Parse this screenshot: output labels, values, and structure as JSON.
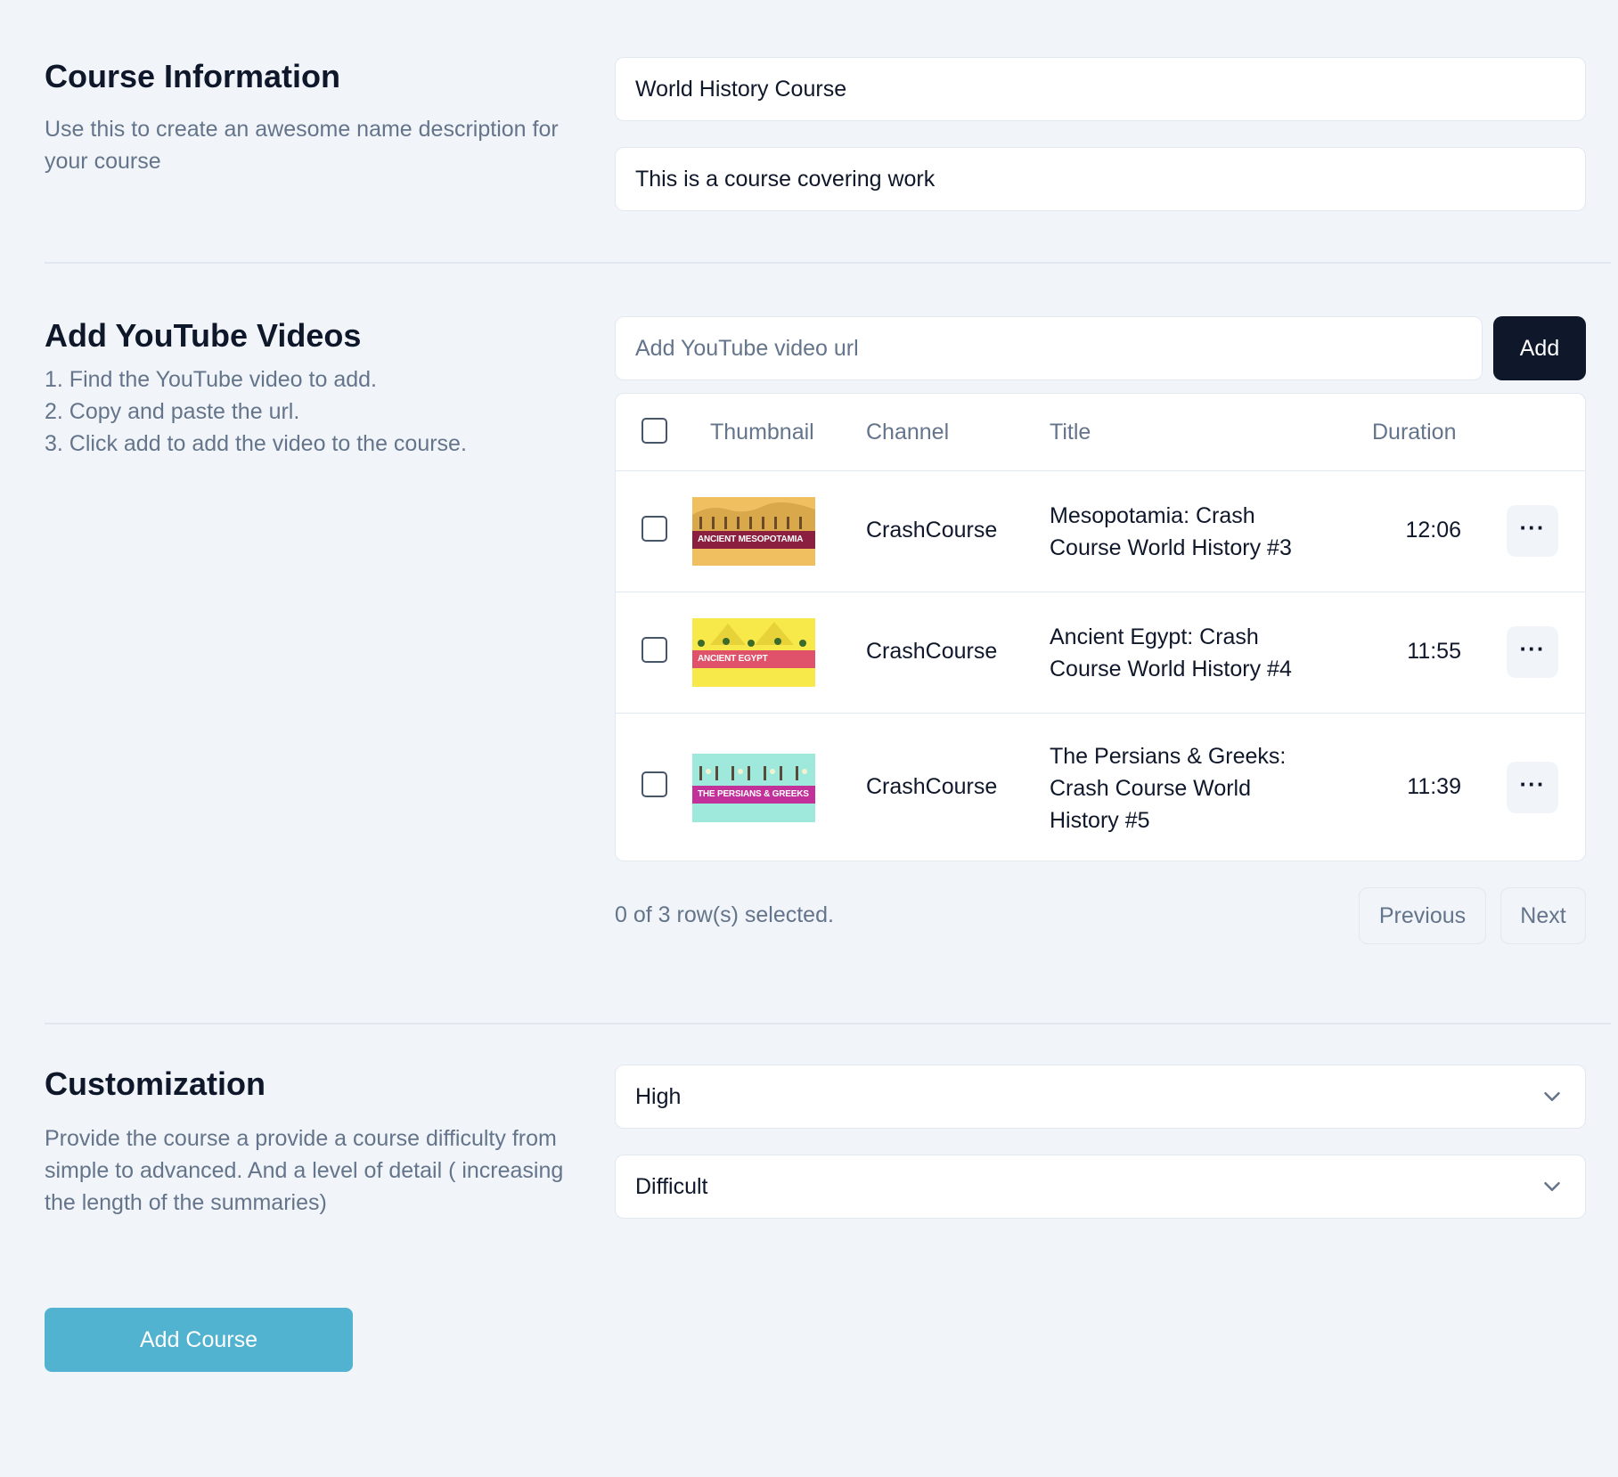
{
  "course_info": {
    "heading": "Course Information",
    "description": "Use this to create an awesome name description for your course",
    "name_value": "World History Course",
    "description_value": "This is a course covering work"
  },
  "videos": {
    "heading": "Add YouTube Videos",
    "steps": [
      "1. Find the YouTube video to add.",
      "2. Copy and paste the url.",
      "3. Click add to add the video to the course."
    ],
    "url_placeholder": "Add YouTube video url",
    "add_label": "Add",
    "columns": [
      "Thumbnail",
      "Channel",
      "Title",
      "Duration"
    ],
    "rows": [
      {
        "thumb_text": "ANCIENT MESOPOTAMIA",
        "thumb_bg": "#f0c060",
        "thumb_band": "#8a1f3f",
        "channel": "CrashCourse",
        "title": "Mesopotamia: Crash Course World History #3",
        "duration": "12:06"
      },
      {
        "thumb_text": "ANCIENT EGYPT",
        "thumb_bg": "#f7e94a",
        "thumb_band": "#e0516a",
        "channel": "CrashCourse",
        "title": "Ancient Egypt: Crash Course World History #4",
        "duration": "11:55"
      },
      {
        "thumb_text": "THE PERSIANS & GREEKS",
        "thumb_bg": "#9fe8dc",
        "thumb_band": "#c2309a",
        "channel": "CrashCourse",
        "title": "The Persians & Greeks: Crash Course World History #5",
        "duration": "11:39"
      }
    ],
    "selection_text": "0 of 3 row(s) selected.",
    "previous_label": "Previous",
    "next_label": "Next",
    "more_icon": "ellipsis-icon"
  },
  "customization": {
    "heading": "Customization",
    "description": "Provide the course a provide a course difficulty from simple to advanced. And a level of detail ( increasing the length of the summaries)",
    "detail_value": "High",
    "difficulty_value": "Difficult"
  },
  "submit_label": "Add Course",
  "colors": {
    "background": "#f1f5f9",
    "primary_dark": "#0f172a",
    "accent": "#52b3d1",
    "muted": "#64748b"
  }
}
